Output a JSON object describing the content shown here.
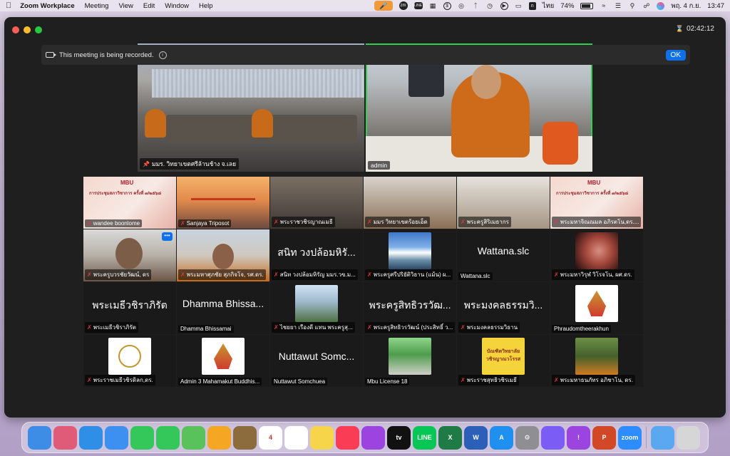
{
  "menubar": {
    "app_name": "Zoom Workplace",
    "menus": [
      "Meeting",
      "View",
      "Edit",
      "Window",
      "Help"
    ],
    "input_lang": "ไทย",
    "battery": "74%",
    "date": "พฤ. 4 ก.ย.",
    "time": "13:47"
  },
  "window": {
    "timer": "02:42:12",
    "recording_message": "This meeting is being recorded.",
    "ok_label": "OK"
  },
  "featured": [
    {
      "name": "มมร. วิทยาเขตศรีล้านช้าง จ.เลย"
    },
    {
      "name": "admin"
    }
  ],
  "gallery": [
    {
      "name": "wandee boonlome",
      "muted": true
    },
    {
      "name": "Sanjaya Triposot",
      "muted": true
    },
    {
      "name": "พระราชวชิรญาณเมธี",
      "muted": true
    },
    {
      "name": "มมร วิทยาเขตร้อยเอ็ด",
      "muted": true
    },
    {
      "name": "พระครูสิริเมธากร",
      "muted": true
    },
    {
      "name": "พระมหาจิณณมล อภิรตโน,ดร....",
      "muted": true
    },
    {
      "name": "พระครูบวรชัยวัฒน์, ดร",
      "muted": true
    },
    {
      "name": "พระมหาศุภชัย สุภกิจโจ, รศ.ดร.",
      "muted": true
    },
    {
      "name": "สนิท วงปล้อมหิรัญ มมร.วข.ม...",
      "display": "สนิท วงปล้อมหิรั...",
      "muted": true
    },
    {
      "name": "พระครูศรีปริยัติวิธาน (แม้น) ผ...",
      "muted": true
    },
    {
      "name": "Wattana.slc",
      "display": "Wattana.slc",
      "muted": false
    },
    {
      "name": "พระมหาวิรุฬ วิโรจโน, ผศ.ดร.",
      "muted": true
    },
    {
      "name": "พระเมธีวชิราภิรัต",
      "display": "พระเมธีวชิราภิรัต",
      "muted": true
    },
    {
      "name": "Dhamma Bhissamai",
      "display": "Dhamma Bhissa...",
      "muted": false
    },
    {
      "name": "ไชยยา เรืองดี แทน พระครูสุ...",
      "muted": true
    },
    {
      "name": "พระครูสิทธิวรวัฒน์ (ประสิทธิ์ ว...",
      "display": "พระครูสิทธิวรวัฒ...",
      "muted": true
    },
    {
      "name": "พระมงคลธรรมวิธาน",
      "display": "พระมงคลธรรมวิ...",
      "muted": true
    },
    {
      "name": "Phraudomtheerakhun",
      "muted": false
    },
    {
      "name": "พระราชเมธีวชิรดิลก,ดร.",
      "muted": true
    },
    {
      "name": "Admin 3 Mahamakut Buddhis...",
      "muted": false
    },
    {
      "name": "Nuttawut Somchuea",
      "display": "Nuttawut Somc...",
      "muted": false
    },
    {
      "name": "Mbu License 18",
      "muted": false
    },
    {
      "name": "พระราชสุทธิวชิรเมธี",
      "muted": true
    },
    {
      "name": "พระมหาธนภัทร อภิชาโน, ดร.",
      "muted": true
    }
  ],
  "slide_text": {
    "title": "การประชุมสภาวิชาการ ครั้งที่ ๗/๒๕๖๘",
    "logo": "MBU"
  },
  "yellow_sign": "บัณฑิตวิทยาลัย วชิรญาณวโรรส",
  "dock": [
    {
      "name": "finder-icon",
      "color": "#3d8de6",
      "label": ""
    },
    {
      "name": "launchpad-icon",
      "color": "#e05b78",
      "label": ""
    },
    {
      "name": "safari-icon",
      "color": "#2f8fe6",
      "label": ""
    },
    {
      "name": "mail-icon",
      "color": "#3d8ff0",
      "label": ""
    },
    {
      "name": "facetime-icon",
      "color": "#34c759",
      "label": ""
    },
    {
      "name": "messages-icon",
      "color": "#34c759",
      "label": ""
    },
    {
      "name": "maps-icon",
      "color": "#5ac25a",
      "label": ""
    },
    {
      "name": "photos-icon",
      "color": "#f5a623",
      "label": ""
    },
    {
      "name": "app-icon",
      "color": "#8c6b3c",
      "label": ""
    },
    {
      "name": "calendar-icon",
      "color": "#ffffff",
      "label": "4"
    },
    {
      "name": "reminders-icon",
      "color": "#ffffff",
      "label": ""
    },
    {
      "name": "notes-icon",
      "color": "#f7d54a",
      "label": ""
    },
    {
      "name": "music-icon",
      "color": "#fa3c55",
      "label": ""
    },
    {
      "name": "podcasts-icon",
      "color": "#9b44e0",
      "label": ""
    },
    {
      "name": "tv-icon",
      "color": "#111111",
      "label": "tv"
    },
    {
      "name": "line-icon",
      "color": "#06c755",
      "label": "LINE"
    },
    {
      "name": "excel-icon",
      "color": "#1e7b45",
      "label": "X"
    },
    {
      "name": "word-icon",
      "color": "#2b5fb8",
      "label": "W"
    },
    {
      "name": "app-store-icon",
      "color": "#1f8ff0",
      "label": "A"
    },
    {
      "name": "system-settings-icon",
      "color": "#8e8e93",
      "label": "⚙"
    },
    {
      "name": "messenger-icon",
      "color": "#7b5cf5",
      "label": ""
    },
    {
      "name": "feedback-icon",
      "color": "#9b44e0",
      "label": "!"
    },
    {
      "name": "powerpoint-icon",
      "color": "#d24726",
      "label": "P"
    },
    {
      "name": "zoom-icon",
      "color": "#2d8cff",
      "label": "zoom"
    },
    {
      "name": "downloads-icon",
      "color": "#5aa8f0",
      "label": ""
    },
    {
      "name": "trash-icon",
      "color": "#d6d6d6",
      "label": ""
    }
  ]
}
